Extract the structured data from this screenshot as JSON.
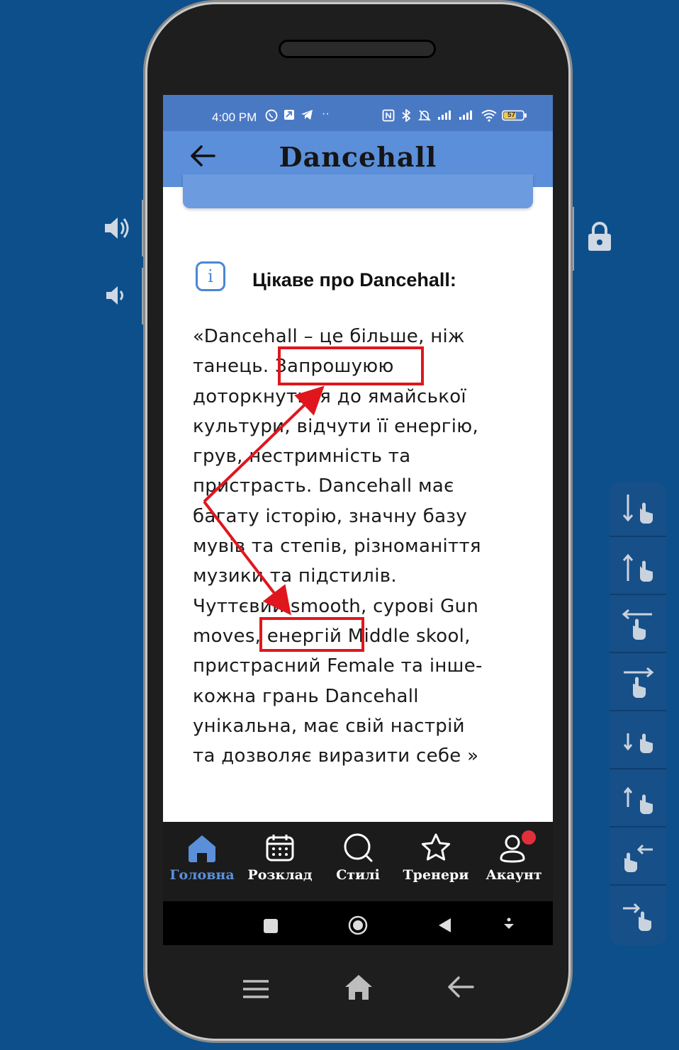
{
  "status_bar": {
    "time": "4:00 PM",
    "battery": "57",
    "icons": [
      "viber-icon",
      "app-icon",
      "telegram-icon",
      "more-dots-icon",
      "nfc-icon",
      "bluetooth-icon",
      "mute-icon",
      "signal-icon",
      "signal-icon",
      "wifi-icon",
      "battery-icon"
    ]
  },
  "app_bar": {
    "back_icon": "arrow-left-icon",
    "title": "Dancehall"
  },
  "info": {
    "icon": "info-icon",
    "title": "Цікаве про Dancehall:"
  },
  "quote_lines": [
    "«Dancehall – це більше, ніж",
    "танець. Запрошуюю",
    "доторкнутися до ямайської",
    "культури, відчути  її енергію,",
    "грув, нестримність та",
    "пристрасть. Dancehall має",
    "багату історію, значну базу",
    "мувів та степів, різноманіття",
    "музики та підстилів.",
    "Чуттєвий smooth, сурові Gun",
    "moves, енергій Middle skool,",
    "пристрасний Female та інше-",
    "кожна грань Dancehall",
    "унікальна, має свій настрій",
    "та дозволяє виразити себе  »"
  ],
  "bottom_nav": [
    {
      "label": "Головна",
      "icon": "home-icon",
      "active": true
    },
    {
      "label": "Розклад",
      "icon": "calendar-icon",
      "active": false
    },
    {
      "label": "Стилі",
      "icon": "search-icon",
      "active": false
    },
    {
      "label": "Тренери",
      "icon": "star-icon",
      "active": false
    },
    {
      "label": "Акаунт",
      "icon": "user-icon",
      "active": false,
      "badge": true
    }
  ],
  "annotations": {
    "box1_text": "Запрошуюю",
    "box2_text": "енергій M",
    "color": "#e0161e"
  },
  "colors": {
    "background": "#0c4f8b",
    "status_bar": "#4a79c4",
    "app_bar": "#5b8fd9",
    "accent": "#4a86d6",
    "nav_bar": "#1b1b1b",
    "badge": "#e0303c"
  }
}
